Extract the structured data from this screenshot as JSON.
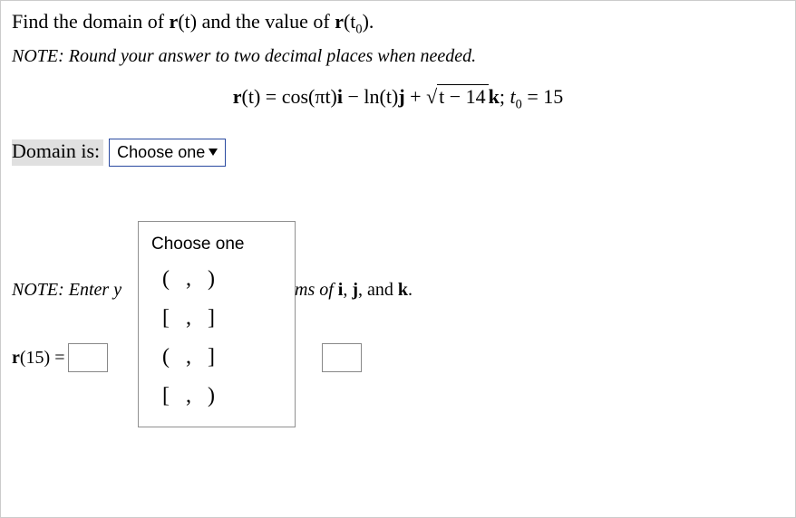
{
  "question": {
    "prefix": "Find the domain of ",
    "r_t": "r",
    "arg_t": "(t)",
    "mid": " and the value of ",
    "r_t0_fn": "r",
    "r_t0_open": "(t",
    "r_t0_sub": "0",
    "r_t0_close": ")",
    "period": "."
  },
  "note1": "NOTE:  Round your answer to two decimal places when needed.",
  "equation": {
    "lhs_fn": "r",
    "lhs_arg": "(t) = cos(πt)",
    "i": "i",
    "minus": " − ln(t)",
    "j": "j",
    "plus": " + ",
    "sqrt_sym": "√",
    "radicand": "t − 14",
    "k": "k",
    "sep": "; ",
    "t0_var": "t",
    "t0_sub": "0",
    "eq": " = 15"
  },
  "domain": {
    "label": "Domain is:",
    "selected": "Choose one",
    "options_header": "Choose one",
    "options": [
      "( , )",
      "[ , ]",
      "( , ]",
      "[ , )"
    ]
  },
  "note2": {
    "left": "NOTE:  Enter y",
    "right_prefix": "ms of ",
    "i": "i",
    "comma1": ", ",
    "j": "j",
    "comma2": ", and ",
    "k": "k",
    "period": "."
  },
  "answer": {
    "fn": "r",
    "arg": "(15) ="
  }
}
